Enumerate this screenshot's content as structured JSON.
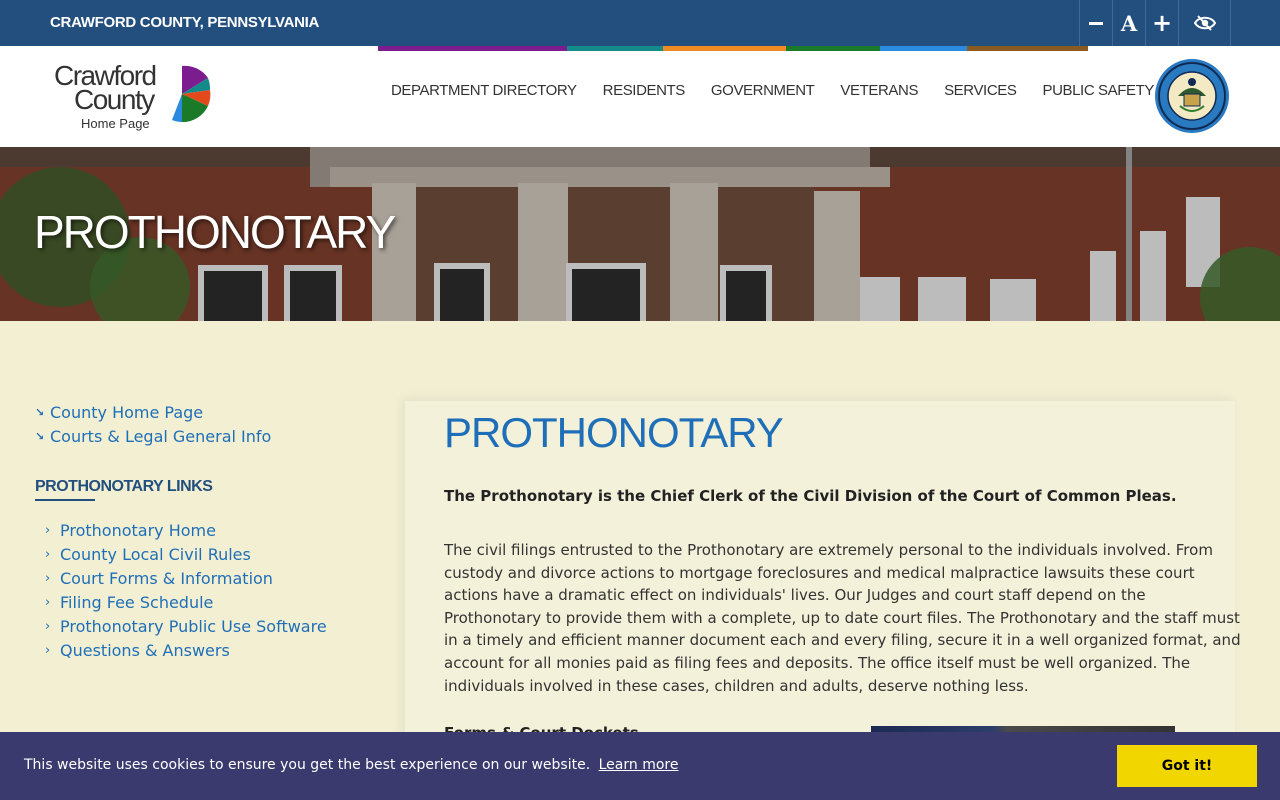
{
  "topbar": {
    "county_name": "CRAWFORD COUNTY, PENNSYLVANIA",
    "tools": [
      {
        "icon": "minus-icon",
        "purpose": "decrease text size"
      },
      {
        "icon": "font-size-icon",
        "glyph": "A"
      },
      {
        "icon": "plus-icon",
        "glyph": "+"
      },
      {
        "icon": "eye-slash-icon"
      }
    ]
  },
  "logo": {
    "line1": "Crawford",
    "line2": "County",
    "line3": "Home Page"
  },
  "nav": {
    "items": [
      {
        "label": "DEPARTMENT DIRECTORY",
        "color": "#7b1d8f"
      },
      {
        "label": "RESIDENTS",
        "color": "#138b8b"
      },
      {
        "label": "GOVERNMENT",
        "color": "#f08a24"
      },
      {
        "label": "VETERANS",
        "color": "#1a7a2a"
      },
      {
        "label": "SERVICES",
        "color": "#2a8ae0"
      },
      {
        "label": "PUBLIC SAFETY",
        "color": "#8b5a1e"
      }
    ]
  },
  "hero": {
    "title": "PROTHONOTARY"
  },
  "sidebar": {
    "top_links": [
      "County Home Page",
      "Courts & Legal General Info"
    ],
    "heading": "PROTHONOTARY LINKS",
    "links": [
      "Prothonotary Home",
      "County Local Civil Rules",
      "Court Forms & Information",
      "Filing Fee Schedule",
      "Prothonotary Public Use Software",
      "Questions & Answers"
    ]
  },
  "main": {
    "title": "PROTHONOTARY",
    "lead": "The Prothonotary is the Chief Clerk of the Civil Division of the Court of Common Pleas.",
    "body": "The civil filings entrusted to the Prothonotary are extremely personal to the individuals involved. From custody and divorce actions to mortgage foreclosures and medical malpractice lawsuits these court actions have a dramatic effect on individuals' lives. Our Judges and court staff depend on the Prothonotary to provide them with a complete, up to date court files. The Prothonotary and the staff must in a timely and efficient manner document each and every filing, secure it in a well organized format, and account for all monies paid as filing fees and deposits. The office itself must be well organized. The individuals involved in these cases, children and adults, deserve nothing less.",
    "subhead": "Forms & Court Dockets"
  },
  "cookie": {
    "message": "This website uses cookies to ensure you get the best experience on our website.",
    "learn_more": "Learn more",
    "button": "Got it!"
  },
  "colors": {
    "topbar": "#234f7f",
    "link": "#1f6fb8",
    "page_bg": "#f2efd3",
    "cookie_bg": "#3a3a6e",
    "cookie_button": "#f1d600"
  }
}
